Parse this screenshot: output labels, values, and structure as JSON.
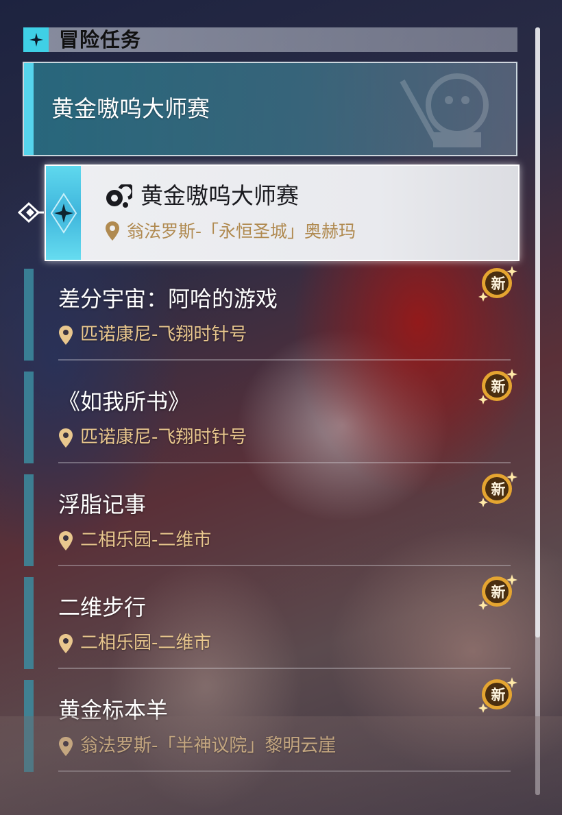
{
  "section": {
    "title": "冒险任务",
    "icon": "diamond-star-icon"
  },
  "group": {
    "title": "黄金嗷呜大师赛"
  },
  "selected_quest": {
    "title": "黄金嗷呜大师赛",
    "location": "翁法罗斯-「永恒圣城」奥赫玛"
  },
  "quests": [
    {
      "title": "差分宇宙：阿哈的游戏",
      "location": "匹诺康尼-飞翔时针号",
      "badge": "新"
    },
    {
      "title": "《如我所书》",
      "location": "匹诺康尼-飞翔时针号",
      "badge": "新"
    },
    {
      "title": "浮脂记事",
      "location": "二相乐园-二维市",
      "badge": "新"
    },
    {
      "title": "二维步行",
      "location": "二相乐园-二维市",
      "badge": "新"
    },
    {
      "title": "黄金标本羊",
      "location": "翁法罗斯-「半神议院」黎明云崖",
      "badge": "新"
    }
  ],
  "colors": {
    "accent_cyan": "#56d4ec",
    "location_gold": "#e9c78e",
    "badge_gold": "#e5a531"
  }
}
